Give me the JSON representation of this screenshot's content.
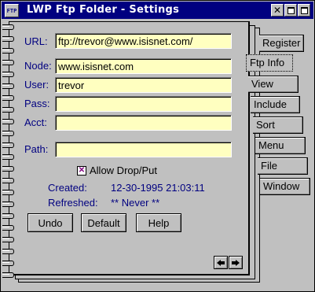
{
  "window": {
    "title": "LWP Ftp Folder  -  Settings",
    "sys_icon_text": "FTP"
  },
  "form": {
    "url_label": "URL:",
    "url_value": "ftp://trevor@www.isisnet.com/",
    "node_label": "Node:",
    "node_value": "www.isisnet.com",
    "user_label": "User:",
    "user_value": "trevor",
    "pass_label": "Pass:",
    "pass_value": "",
    "acct_label": "Acct:",
    "acct_value": "",
    "path_label": "Path:",
    "path_value": "",
    "allow_label": "Allow Drop/Put",
    "allow_checked": true,
    "created_label": "Created:",
    "created_value": "12-30-1995 21:03:11",
    "refreshed_label": "Refreshed:",
    "refreshed_value": "** Never **"
  },
  "buttons": {
    "undo": "Undo",
    "default": "Default",
    "help": "Help"
  },
  "tabs": [
    "Register",
    "Ftp Info",
    "View",
    "Include",
    "Sort",
    "Menu",
    "File",
    "Window"
  ],
  "active_tab": "Ftp Info",
  "colors": {
    "titlebar": "#000080",
    "label_text": "#000080",
    "field_bg": "#ffffc0",
    "face": "#c0c0c0"
  }
}
